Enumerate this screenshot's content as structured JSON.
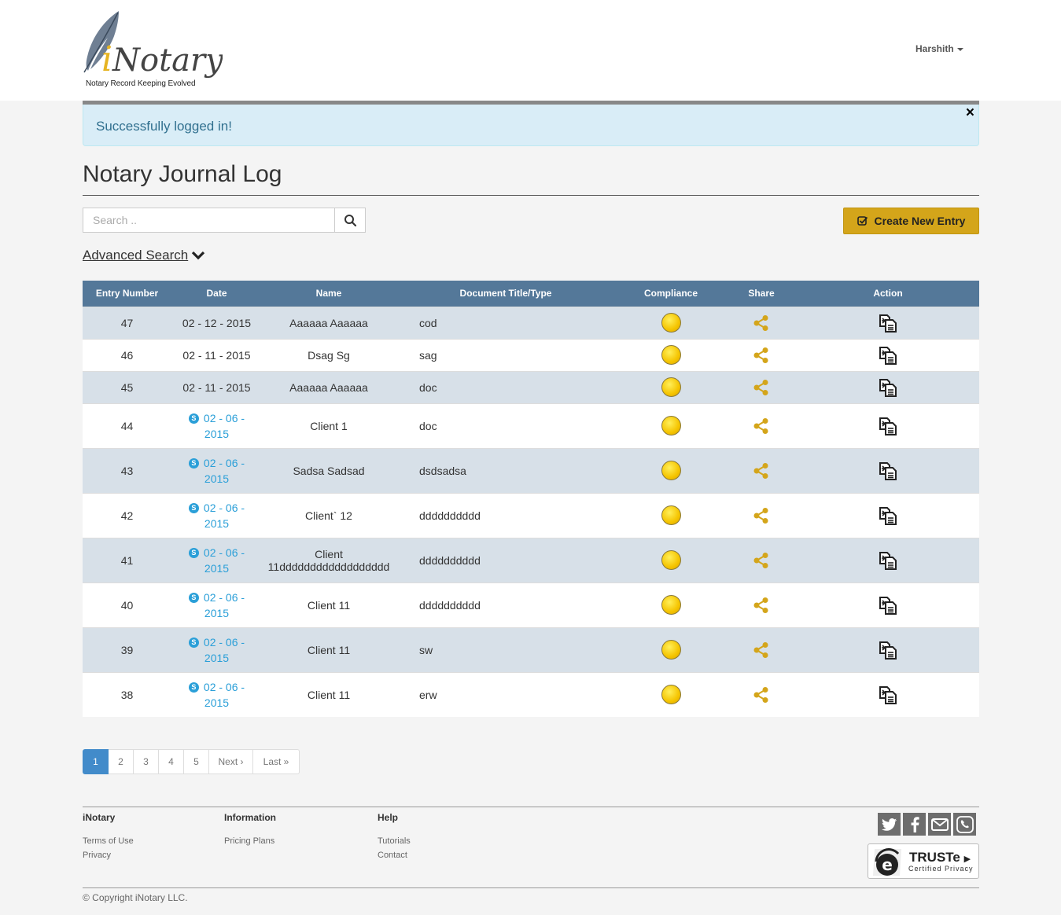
{
  "header": {
    "logo_text": "iNotary",
    "logo_tagline": "Notary Record Keeping Evolved",
    "user_name": "Harshith"
  },
  "alert": {
    "message": "Successfully logged in!",
    "close_glyph": "×"
  },
  "page": {
    "title": "Notary Journal Log"
  },
  "search": {
    "placeholder": "Search ..",
    "value": ""
  },
  "create_button": {
    "label": "Create New Entry"
  },
  "advanced_search": {
    "label": "Advanced Search"
  },
  "table": {
    "columns": [
      "Entry Number",
      "Date",
      "Name",
      "Document Title/Type",
      "Compliance",
      "Share",
      "Action"
    ],
    "rows": [
      {
        "entry": "47",
        "date": "02 - 12 - 2015",
        "remote": false,
        "name": "Aaaaaa Aaaaaa",
        "doc": "cod"
      },
      {
        "entry": "46",
        "date": "02 - 11 - 2015",
        "remote": false,
        "name": "Dsag Sg",
        "doc": "sag"
      },
      {
        "entry": "45",
        "date": "02 - 11 - 2015",
        "remote": false,
        "name": "Aaaaaa Aaaaaa",
        "doc": "doc"
      },
      {
        "entry": "44",
        "date_top": "02 - 06 -",
        "date_bottom": "2015",
        "remote": true,
        "name": "Client 1",
        "doc": "doc"
      },
      {
        "entry": "43",
        "date_top": "02 - 06 -",
        "date_bottom": "2015",
        "remote": true,
        "name": "Sadsa Sadsad",
        "doc": "dsdsadsa"
      },
      {
        "entry": "42",
        "date_top": "02 - 06 -",
        "date_bottom": "2015",
        "remote": true,
        "name": "Client` 12",
        "doc": "dddddddddd"
      },
      {
        "entry": "41",
        "date_top": "02 - 06 -",
        "date_bottom": "2015",
        "remote": true,
        "name": "Client 11dddddddddddddddddd",
        "doc": "dddddddddd"
      },
      {
        "entry": "40",
        "date_top": "02 - 06 -",
        "date_bottom": "2015",
        "remote": true,
        "name": "Client 11",
        "doc": "dddddddddd"
      },
      {
        "entry": "39",
        "date_top": "02 - 06 -",
        "date_bottom": "2015",
        "remote": true,
        "name": "Client 11",
        "doc": "sw"
      },
      {
        "entry": "38",
        "date_top": "02 - 06 -",
        "date_bottom": "2015",
        "remote": true,
        "name": "Client 11",
        "doc": "erw"
      }
    ],
    "compliance_color": "#f5c400",
    "share_color": "#d4a51a",
    "compliance_icon": "compliance-dot-icon",
    "share_icon": "share-icon",
    "action_icon": "copy-document-icon",
    "remote_icon": "skype-icon"
  },
  "pagination": {
    "pages": [
      "1",
      "2",
      "3",
      "4",
      "5"
    ],
    "active": "1",
    "next": "Next ›",
    "last": "Last »"
  },
  "footer": {
    "col1": {
      "title": "iNotary",
      "links": [
        "Terms of Use",
        "Privacy"
      ]
    },
    "col2": {
      "title": "Information",
      "links": [
        "Pricing Plans"
      ]
    },
    "col3": {
      "title": "Help",
      "links": [
        "Tutorials",
        "Contact"
      ]
    },
    "social": [
      "twitter-icon",
      "facebook-icon",
      "email-icon",
      "phone-icon"
    ],
    "truste": {
      "name": "TRUSTe",
      "sub": "Certified Privacy"
    },
    "copyright": "© Copyright iNotary LLC."
  },
  "colors": {
    "header_bar": "#547899",
    "accent": "#d4a51a",
    "alert_bg": "#d9edf7",
    "alert_text": "#31708f",
    "link": "#2a9fd8"
  }
}
